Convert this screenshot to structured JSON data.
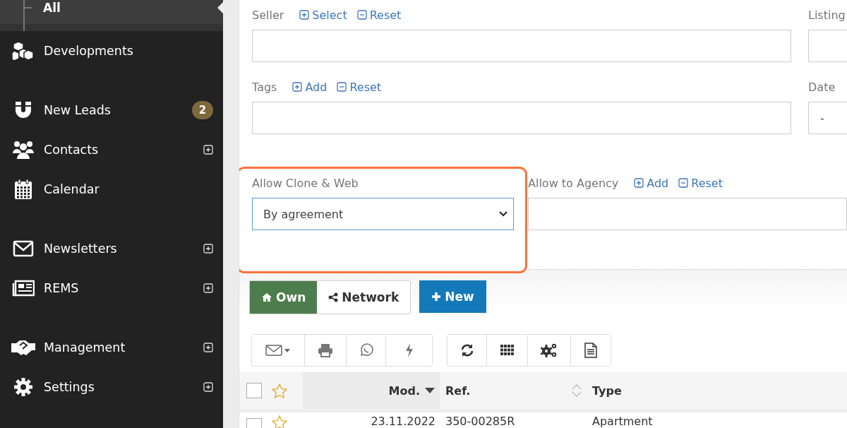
{
  "sidebar": {
    "subitem": {
      "label": "All",
      "selected": true
    },
    "groups": [
      [
        {
          "label": "Developments",
          "expandable": false,
          "selected": false
        }
      ],
      [
        {
          "label": "New Leads",
          "badge": "2",
          "expandable": false,
          "selected": false
        },
        {
          "label": "Contacts",
          "expandable": true,
          "selected": false
        },
        {
          "label": "Calendar",
          "expandable": false,
          "selected": false
        }
      ],
      [
        {
          "label": "Newsletters",
          "expandable": true,
          "selected": false
        },
        {
          "label": "REMS",
          "expandable": true,
          "selected": false
        }
      ],
      [
        {
          "label": "Management",
          "expandable": true,
          "selected": false
        },
        {
          "label": "Settings",
          "expandable": true,
          "selected": false
        }
      ]
    ]
  },
  "filters": [
    {
      "label": "Seller",
      "actions": [
        {
          "kind": "add",
          "label": "Select"
        },
        {
          "kind": "reset",
          "label": "Reset"
        }
      ]
    },
    {
      "label": "Listing"
    },
    {
      "label": "Tags",
      "actions": [
        {
          "kind": "add",
          "label": "Add"
        },
        {
          "kind": "reset",
          "label": "Reset"
        }
      ]
    },
    {
      "label": "Date",
      "value": "-"
    }
  ],
  "clone_field": {
    "label": "Allow Clone & Web",
    "value": "By agreement",
    "highlighted": true
  },
  "agency_field": {
    "label": "Allow to Agency",
    "actions": [
      {
        "kind": "add",
        "label": "Add"
      },
      {
        "kind": "reset",
        "label": "Reset"
      }
    ]
  },
  "view_toggle": [
    {
      "label": "Own",
      "selected": true
    },
    {
      "label": "Network",
      "selected": false
    }
  ],
  "new_button": {
    "label": "New"
  },
  "table": {
    "all_checked": false,
    "columns": [
      {
        "label": "Mod.",
        "sorted": true
      },
      {
        "label": "Ref.",
        "sorted": false,
        "sortable": true
      },
      {
        "label": "Type",
        "sorted": false,
        "sortable": false
      }
    ],
    "rows": [
      {
        "checked": false,
        "starred": false,
        "cells": [
          "23.11.2022",
          "350-00285R",
          "Apartment"
        ]
      }
    ]
  }
}
